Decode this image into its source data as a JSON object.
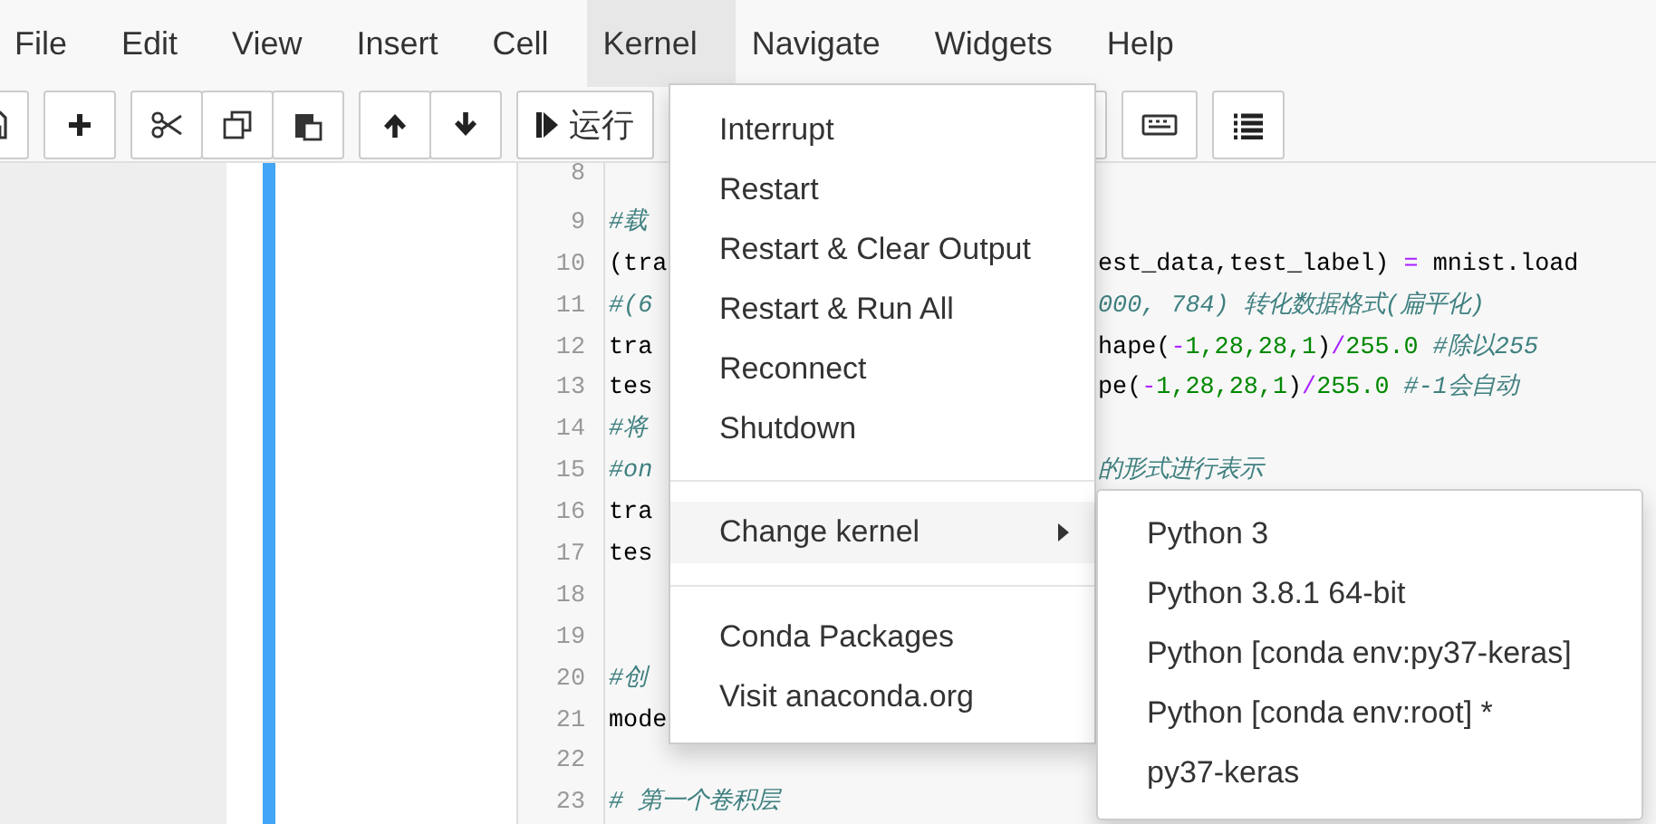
{
  "menu_bar": [
    {
      "label": "File",
      "selected": false
    },
    {
      "label": "Edit",
      "selected": false
    },
    {
      "label": "View",
      "selected": false
    },
    {
      "label": "Insert",
      "selected": false
    },
    {
      "label": "Cell",
      "selected": false
    },
    {
      "label": "Kernel",
      "selected": true
    },
    {
      "label": "Navigate",
      "selected": false
    },
    {
      "label": "Widgets",
      "selected": false
    },
    {
      "label": "Help",
      "selected": false
    }
  ],
  "toolbar": {
    "run_label": "运行"
  },
  "code_cell": {
    "lines": [
      {
        "number": "8"
      },
      {
        "number": "9",
        "left": [
          {
            "text": "#载",
            "kind": "comment"
          }
        ]
      },
      {
        "number": "10",
        "left": [
          {
            "text": "(tra",
            "kind": "plain"
          }
        ],
        "right": [
          {
            "text": "est_data,test_label) ",
            "kind": "plain"
          },
          {
            "text": "=",
            "kind": "operator"
          },
          {
            "text": " mnist.load",
            "kind": "plain"
          }
        ]
      },
      {
        "number": "11",
        "left": [
          {
            "text": "#(6",
            "kind": "comment"
          }
        ],
        "right": [
          {
            "text": "000, 784)  转化数据格式(扁平化)",
            "kind": "comment"
          }
        ]
      },
      {
        "number": "12",
        "left": [
          {
            "text": "tra",
            "kind": "plain"
          }
        ],
        "right": [
          {
            "text": "hape(",
            "kind": "plain"
          },
          {
            "text": "-",
            "kind": "operator"
          },
          {
            "text": "1,28,28,1",
            "kind": "number"
          },
          {
            "text": ")",
            "kind": "plain"
          },
          {
            "text": "/",
            "kind": "operator"
          },
          {
            "text": "255.0",
            "kind": "number"
          },
          {
            "text": "  #除以255",
            "kind": "comment"
          }
        ]
      },
      {
        "number": "13",
        "left": [
          {
            "text": "tes",
            "kind": "plain"
          }
        ],
        "right": [
          {
            "text": "pe(",
            "kind": "plain"
          },
          {
            "text": "-",
            "kind": "operator"
          },
          {
            "text": "1,28,28,1",
            "kind": "number"
          },
          {
            "text": ")",
            "kind": "plain"
          },
          {
            "text": "/",
            "kind": "operator"
          },
          {
            "text": "255.0",
            "kind": "number"
          },
          {
            "text": "   #-1会自动",
            "kind": "comment"
          }
        ]
      },
      {
        "number": "14",
        "left": [
          {
            "text": "#将",
            "kind": "comment"
          }
        ]
      },
      {
        "number": "15",
        "left": [
          {
            "text": "#on",
            "kind": "comment"
          }
        ],
        "right": [
          {
            "text": "的形式进行表示",
            "kind": "comment"
          }
        ]
      },
      {
        "number": "16",
        "left": [
          {
            "text": "tra",
            "kind": "plain"
          }
        ]
      },
      {
        "number": "17",
        "left": [
          {
            "text": "tes",
            "kind": "plain"
          }
        ]
      },
      {
        "number": "18"
      },
      {
        "number": "19"
      },
      {
        "number": "20",
        "left": [
          {
            "text": "#创",
            "kind": "comment"
          }
        ]
      },
      {
        "number": "21",
        "left": [
          {
            "text": "mode",
            "kind": "plain"
          }
        ]
      },
      {
        "number": "22"
      },
      {
        "number": "23",
        "left": [
          {
            "text": "# 第一个卷积层",
            "kind": "comment"
          }
        ]
      }
    ]
  },
  "kernel_menu": {
    "items": [
      {
        "kind": "item",
        "label": "Interrupt"
      },
      {
        "kind": "item",
        "label": "Restart"
      },
      {
        "kind": "item",
        "label": "Restart & Clear Output"
      },
      {
        "kind": "item",
        "label": "Restart & Run All"
      },
      {
        "kind": "item",
        "label": "Reconnect"
      },
      {
        "kind": "item",
        "label": "Shutdown"
      },
      {
        "kind": "divider"
      },
      {
        "kind": "submenu",
        "label": "Change kernel",
        "selected": true
      },
      {
        "kind": "divider"
      },
      {
        "kind": "item",
        "label": "Conda Packages"
      },
      {
        "kind": "item",
        "label": "Visit anaconda.org"
      }
    ]
  },
  "change_kernel_submenu": {
    "items": [
      {
        "label": "Python 3"
      },
      {
        "label": "Python 3.8.1 64-bit"
      },
      {
        "label": "Python [conda env:py37-keras]"
      },
      {
        "label": "Python [conda env:root] *"
      },
      {
        "label": "py37-keras"
      }
    ]
  }
}
